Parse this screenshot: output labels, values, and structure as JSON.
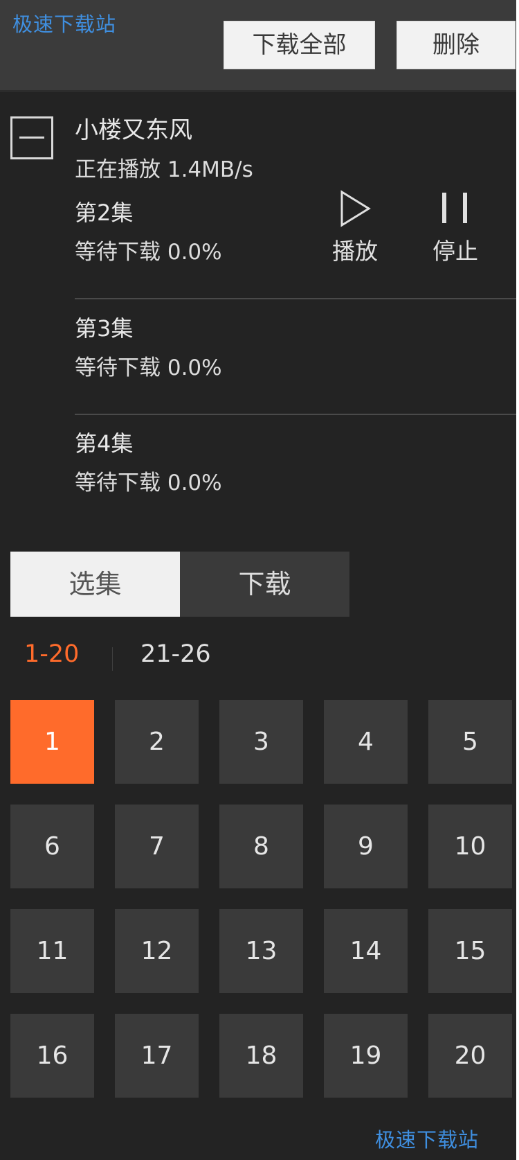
{
  "watermark": "极速下载站",
  "toolbar": {
    "download_all_label": "下载全部",
    "delete_label": "删除"
  },
  "series": {
    "title": "小楼又东风",
    "status": "正在播放 1.4MB/s",
    "collapse_icon": "minus-icon"
  },
  "download_items": [
    {
      "title": "第2集",
      "status": "等待下载 0.0%",
      "actions": {
        "play_label": "播放",
        "stop_label": "停止",
        "play_icon": "play-icon",
        "stop_icon": "pause-icon"
      }
    },
    {
      "title": "第3集",
      "status": "等待下载 0.0%"
    },
    {
      "title": "第4集",
      "status": "等待下载 0.0%"
    }
  ],
  "tabs": [
    {
      "label": "选集",
      "selected": true
    },
    {
      "label": "下载",
      "selected": false
    }
  ],
  "ranges": [
    {
      "label": "1-20",
      "selected": true
    },
    {
      "label": "21-26",
      "selected": false
    }
  ],
  "episodes": [
    "1",
    "2",
    "3",
    "4",
    "5",
    "6",
    "7",
    "8",
    "9",
    "10",
    "11",
    "12",
    "13",
    "14",
    "15",
    "16",
    "17",
    "18",
    "19",
    "20"
  ],
  "selected_episode": "1",
  "colors": {
    "accent": "#ff6b2b",
    "watermark": "#3f8fe0",
    "background": "#232323"
  }
}
